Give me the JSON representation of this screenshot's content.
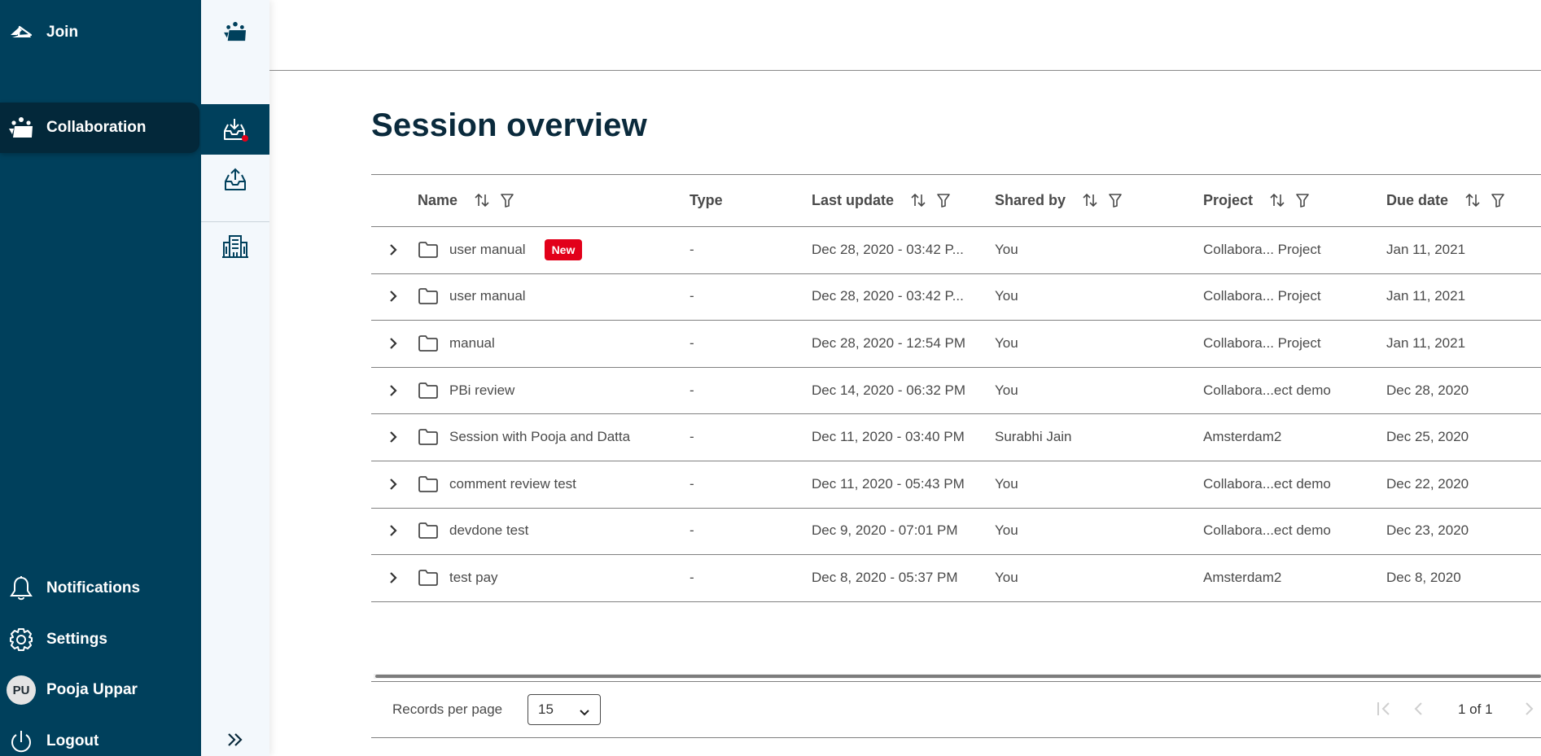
{
  "sidebar": {
    "join": {
      "label": "Join",
      "icon": "join-icon"
    },
    "collaboration": {
      "label": "Collaboration",
      "icon": "collaboration-icon",
      "active": true
    },
    "notifications": {
      "label": "Notifications",
      "icon": "bell-icon"
    },
    "settings": {
      "label": "Settings",
      "icon": "gear-icon"
    },
    "user": {
      "initials": "PU",
      "name": "Pooja Uppar"
    },
    "logout": {
      "label": "Logout",
      "icon": "power-icon"
    }
  },
  "rail": {
    "items": [
      {
        "name": "collaboration",
        "icon": "collaboration-icon"
      },
      {
        "name": "inbox",
        "icon": "inbox-download-icon",
        "active": true,
        "has_notification": true
      },
      {
        "name": "outbox",
        "icon": "outbox-upload-icon"
      },
      {
        "name": "organization",
        "icon": "building-icon"
      }
    ],
    "expand_icon": "double-chevron-right-icon"
  },
  "page": {
    "title": "Session overview"
  },
  "table": {
    "columns": [
      {
        "key": "name",
        "label": "Name",
        "sortable": true,
        "filterable": true
      },
      {
        "key": "type",
        "label": "Type",
        "sortable": false,
        "filterable": false
      },
      {
        "key": "last_update",
        "label": "Last update",
        "sortable": true,
        "filterable": true
      },
      {
        "key": "shared_by",
        "label": "Shared by",
        "sortable": true,
        "filterable": true
      },
      {
        "key": "project",
        "label": "Project",
        "sortable": true,
        "filterable": true
      },
      {
        "key": "due_date",
        "label": "Due date",
        "sortable": true,
        "filterable": true
      }
    ],
    "rows": [
      {
        "name": "user manual",
        "badge": "New",
        "type": "-",
        "last_update": "Dec 28, 2020 - 03:42 P...",
        "shared_by": "You",
        "project": "Collabora... Project",
        "due_date": "Jan 11, 2021"
      },
      {
        "name": "user manual",
        "badge": null,
        "type": "-",
        "last_update": "Dec 28, 2020 - 03:42 P...",
        "shared_by": "You",
        "project": "Collabora... Project",
        "due_date": "Jan 11, 2021"
      },
      {
        "name": "manual",
        "badge": null,
        "type": "-",
        "last_update": "Dec 28, 2020 - 12:54 PM",
        "shared_by": "You",
        "project": "Collabora... Project",
        "due_date": "Jan 11, 2021"
      },
      {
        "name": "PBi review",
        "badge": null,
        "type": "-",
        "last_update": "Dec 14, 2020 - 06:32 PM",
        "shared_by": "You",
        "project": "Collabora...ect demo",
        "due_date": "Dec 28, 2020"
      },
      {
        "name": "Session with Pooja and Datta",
        "badge": null,
        "type": "-",
        "last_update": "Dec 11, 2020 - 03:40 PM",
        "shared_by": "Surabhi Jain",
        "project": "Amsterdam2",
        "due_date": "Dec 25, 2020"
      },
      {
        "name": "comment review test",
        "badge": null,
        "type": "-",
        "last_update": "Dec 11, 2020 - 05:43 PM",
        "shared_by": "You",
        "project": "Collabora...ect demo",
        "due_date": "Dec 22, 2020"
      },
      {
        "name": "devdone test",
        "badge": null,
        "type": "-",
        "last_update": "Dec 9, 2020 - 07:01 PM",
        "shared_by": "You",
        "project": "Collabora...ect demo",
        "due_date": "Dec 23, 2020"
      },
      {
        "name": "test pay",
        "badge": null,
        "type": "-",
        "last_update": "Dec 8, 2020 - 05:37 PM",
        "shared_by": "You",
        "project": "Amsterdam2",
        "due_date": "Dec 8, 2020"
      }
    ]
  },
  "pagination": {
    "records_per_page_label": "Records per page",
    "records_per_page_value": "15",
    "page_text": "1 of 1"
  },
  "colors": {
    "sidebar_bg": "#00405c",
    "sidebar_active_bg": "#03283a",
    "rail_bg": "#f3f8fc",
    "badge_bg": "#e2001a",
    "title_color": "#0a2a3c",
    "notification_dot": "#e2001a"
  }
}
